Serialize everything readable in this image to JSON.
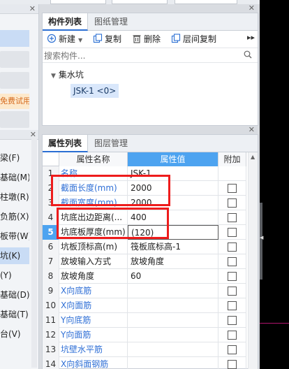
{
  "left_panel": {
    "trial_label": "免费试用",
    "items": [
      {
        "label": "梁(F)",
        "active": false,
        "blue": false
      },
      {
        "label": "基础(M)",
        "active": false,
        "blue": false
      },
      {
        "label": "柱墩(R)",
        "active": false,
        "blue": false
      },
      {
        "label": "负筋(X)",
        "active": false,
        "blue": false
      },
      {
        "label": "板带(W)",
        "active": false,
        "blue": false
      },
      {
        "label": "坑(K)",
        "active": true,
        "blue": false
      },
      {
        "label": "(Y)",
        "active": false,
        "blue": false
      },
      {
        "label": "基础(D)",
        "active": false,
        "blue": false
      },
      {
        "label": "基础(T)",
        "active": false,
        "blue": false
      },
      {
        "label": "台(V)",
        "active": false,
        "blue": false
      },
      {
        "label": "",
        "active": false,
        "blue": true
      }
    ]
  },
  "component_panel": {
    "tabs": [
      "构件列表",
      "图纸管理"
    ],
    "toolbar": {
      "new_label": "新建",
      "copy_label": "复制",
      "delete_label": "删除",
      "floor_copy_label": "层间复制"
    },
    "search_placeholder": "搜索构件...",
    "tree": {
      "root_label": "集水坑",
      "child_label": "JSK-1 <0>"
    }
  },
  "property_panel": {
    "tabs": [
      "属性列表",
      "图层管理"
    ],
    "headers": [
      "属性名称",
      "属性值",
      "附加"
    ],
    "rows": [
      {
        "num": "1",
        "name": "名称",
        "value": "JSK-1",
        "blue": true,
        "checkbox": false
      },
      {
        "num": "2",
        "name": "截面长度(mm)",
        "value": "2000",
        "blue": true,
        "checkbox": true
      },
      {
        "num": "3",
        "name": "截面宽度(mm)",
        "value": "2000",
        "blue": true,
        "checkbox": true
      },
      {
        "num": "4",
        "name": "坑底出边距离(...",
        "value": "400",
        "blue": false,
        "checkbox": true
      },
      {
        "num": "5",
        "name": "坑底板厚度(mm)",
        "value": "(120)",
        "blue": false,
        "checkbox": true,
        "current": true
      },
      {
        "num": "6",
        "name": "坑板顶标高(m)",
        "value": "筏板底标高-1",
        "blue": false,
        "checkbox": true
      },
      {
        "num": "7",
        "name": "放坡输入方式",
        "value": "放坡角度",
        "blue": false,
        "checkbox": true
      },
      {
        "num": "8",
        "name": "放坡角度",
        "value": "60",
        "blue": false,
        "checkbox": true
      },
      {
        "num": "9",
        "name": "X向底筋",
        "value": "",
        "blue": true,
        "checkbox": true
      },
      {
        "num": "10",
        "name": "X向面筋",
        "value": "",
        "blue": true,
        "checkbox": true
      },
      {
        "num": "11",
        "name": "Y向底筋",
        "value": "",
        "blue": true,
        "checkbox": true
      },
      {
        "num": "12",
        "name": "Y向面筋",
        "value": "",
        "blue": true,
        "checkbox": true
      },
      {
        "num": "13",
        "name": "坑壁水平筋",
        "value": "",
        "blue": true,
        "checkbox": true
      },
      {
        "num": "14",
        "name": "X向斜面钢筋",
        "value": "",
        "blue": true,
        "checkbox": true
      }
    ]
  },
  "colors": {
    "accent": "#4da3f0",
    "highlight_box": "#ee1c1c",
    "link_text": "#2f6fd6"
  }
}
